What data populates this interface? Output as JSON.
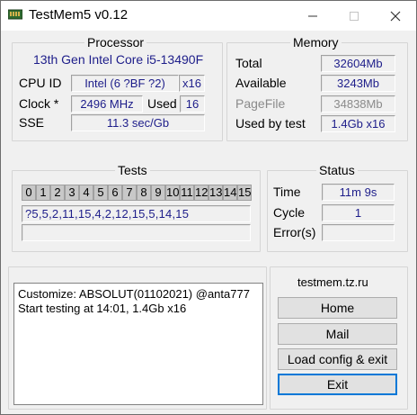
{
  "window": {
    "title": "TestMem5 v0.12"
  },
  "processor": {
    "group_title": "Processor",
    "name": "13th Gen Intel Core i5-13490F",
    "cpu_id_label": "CPU ID",
    "cpu_id_value": "Intel  (6 ?BF ?2)",
    "threads": "x16",
    "clock_label": "Clock *",
    "clock_value": "2496 MHz",
    "used_label": "Used",
    "used_value": "16",
    "sse_label": "SSE",
    "sse_value": "11.3 sec/Gb"
  },
  "memory": {
    "group_title": "Memory",
    "total_label": "Total",
    "total_value": "32604Mb",
    "available_label": "Available",
    "available_value": "3243Mb",
    "pagefile_label": "PageFile",
    "pagefile_value": "34838Mb",
    "used_label": "Used by test",
    "used_value": "1.4Gb x16"
  },
  "tests": {
    "group_title": "Tests",
    "indices": [
      "0",
      "1",
      "2",
      "3",
      "4",
      "5",
      "6",
      "7",
      "8",
      "9",
      "10",
      "11",
      "12",
      "13",
      "14",
      "15"
    ],
    "sequence": "?5,5,2,11,15,4,2,12,15,5,14,15"
  },
  "status": {
    "group_title": "Status",
    "time_label": "Time",
    "time_value": "11m 9s",
    "cycle_label": "Cycle",
    "cycle_value": "1",
    "errors_label": "Error(s)",
    "errors_value": ""
  },
  "log": {
    "lines": [
      "Customize: ABSOLUT(01102021) @anta777",
      "Start testing at 14:01, 1.4Gb x16"
    ]
  },
  "side": {
    "site": "testmem.tz.ru",
    "home": "Home",
    "mail": "Mail",
    "load_config": "Load config & exit",
    "exit": "Exit"
  }
}
